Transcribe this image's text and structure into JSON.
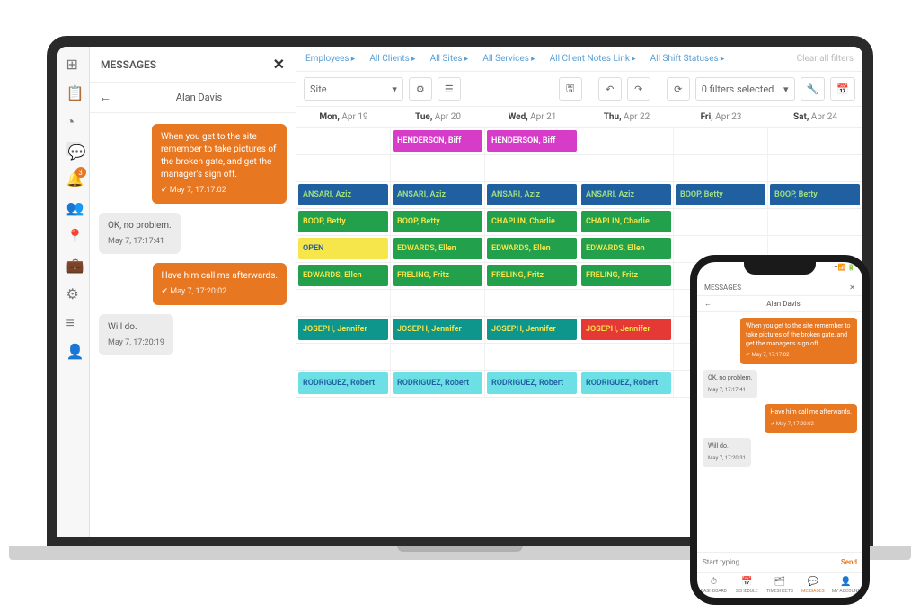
{
  "sidebar": {
    "badge": "3"
  },
  "messages": {
    "title": "MESSAGES",
    "contact": "Alan Davis",
    "thread": [
      {
        "dir": "out",
        "text": "When you get to the site remember to take pictures of the broken gate, and get the manager's sign off.",
        "ts": "May 7, 17:17:02"
      },
      {
        "dir": "in",
        "text": "OK, no problem.",
        "ts": "May 7, 17:17:41"
      },
      {
        "dir": "out",
        "text": "Have him call me afterwards.",
        "ts": "May 7, 17:20:02"
      },
      {
        "dir": "in",
        "text": "Will do.",
        "ts": "May 7, 17:20:19"
      }
    ]
  },
  "filters": {
    "items": [
      "Employees",
      "All Clients",
      "All Sites",
      "All Services",
      "All Client Notes Link",
      "All Shift Statuses"
    ],
    "clear": "Clear all filters"
  },
  "toolbar": {
    "groupby": "Site",
    "filters_sel": "0 filters selected"
  },
  "days": [
    {
      "d": "Mon",
      "dt": "Apr 19"
    },
    {
      "d": "Tue",
      "dt": "Apr 20"
    },
    {
      "d": "Wed",
      "dt": "Apr 21"
    },
    {
      "d": "Thu",
      "dt": "Apr 22"
    },
    {
      "d": "Fri",
      "dt": "Apr 23"
    },
    {
      "d": "Sat",
      "dt": "Apr 24"
    }
  ],
  "rows": [
    [
      null,
      {
        "c": "mag",
        "t": "HENDERSON, Biff"
      },
      {
        "c": "mag",
        "t": "HENDERSON, Biff"
      },
      null,
      null,
      null
    ],
    [
      null,
      null,
      null,
      null,
      null,
      null
    ],
    [
      {
        "c": "blue",
        "t": "ANSARI, Aziz"
      },
      {
        "c": "blue",
        "t": "ANSARI, Aziz"
      },
      {
        "c": "blue",
        "t": "ANSARI, Aziz"
      },
      {
        "c": "blue",
        "t": "ANSARI, Aziz"
      },
      {
        "c": "blue",
        "t": "BOOP, Betty"
      },
      {
        "c": "blue",
        "t": "BOOP, Betty"
      }
    ],
    [
      {
        "c": "green",
        "t": "BOOP, Betty"
      },
      {
        "c": "green",
        "t": "BOOP, Betty"
      },
      {
        "c": "green",
        "t": "CHAPLIN, Charlie"
      },
      {
        "c": "green",
        "t": "CHAPLIN, Charlie"
      },
      null,
      null
    ],
    [
      {
        "c": "yellow",
        "t": "OPEN"
      },
      {
        "c": "green",
        "t": "EDWARDS, Ellen"
      },
      {
        "c": "green",
        "t": "EDWARDS, Ellen"
      },
      {
        "c": "green",
        "t": "EDWARDS, Ellen"
      },
      null,
      null
    ],
    [
      {
        "c": "green",
        "t": "EDWARDS, Ellen"
      },
      {
        "c": "green",
        "t": "FRELING, Fritz"
      },
      {
        "c": "green",
        "t": "FRELING, Fritz"
      },
      {
        "c": "green",
        "t": "FRELING, Fritz"
      },
      null,
      null
    ],
    [
      null,
      null,
      null,
      null,
      null,
      null
    ],
    [
      {
        "c": "teal",
        "t": "JOSEPH, Jennifer"
      },
      {
        "c": "teal",
        "t": "JOSEPH, Jennifer"
      },
      {
        "c": "teal",
        "t": "JOSEPH, Jennifer"
      },
      {
        "c": "red",
        "t": "JOSEPH, Jennifer"
      },
      null,
      null
    ],
    [
      null,
      null,
      null,
      null,
      null,
      null
    ],
    [
      {
        "c": "cyan",
        "t": "RODRIGUEZ, Robert"
      },
      {
        "c": "cyan",
        "t": "RODRIGUEZ, Robert"
      },
      {
        "c": "cyan",
        "t": "RODRIGUEZ, Robert"
      },
      {
        "c": "cyan",
        "t": "RODRIGUEZ, Robert"
      },
      null,
      null
    ]
  ],
  "phone": {
    "title": "MESSAGES",
    "contact": "Alan Davis",
    "thread": [
      {
        "dir": "out",
        "text": "When you get to the site remember to take pictures of the broken gate, and get the manager's sign off.",
        "ts": "May 7, 17:17:02"
      },
      {
        "dir": "in",
        "text": "OK, no problem.",
        "ts": "May 7, 17:17:41"
      },
      {
        "dir": "out",
        "text": "Have him call me afterwards.",
        "ts": "May 7, 17:20:02"
      },
      {
        "dir": "in",
        "text": "Will do.",
        "ts": "May 7, 17:20:31"
      }
    ],
    "placeholder": "Start typing...",
    "send": "Send",
    "tabs": [
      "DASHBOARD",
      "SCHEDULE",
      "TIMESHEETS",
      "MESSAGES",
      "MY ACCOUNT"
    ]
  }
}
